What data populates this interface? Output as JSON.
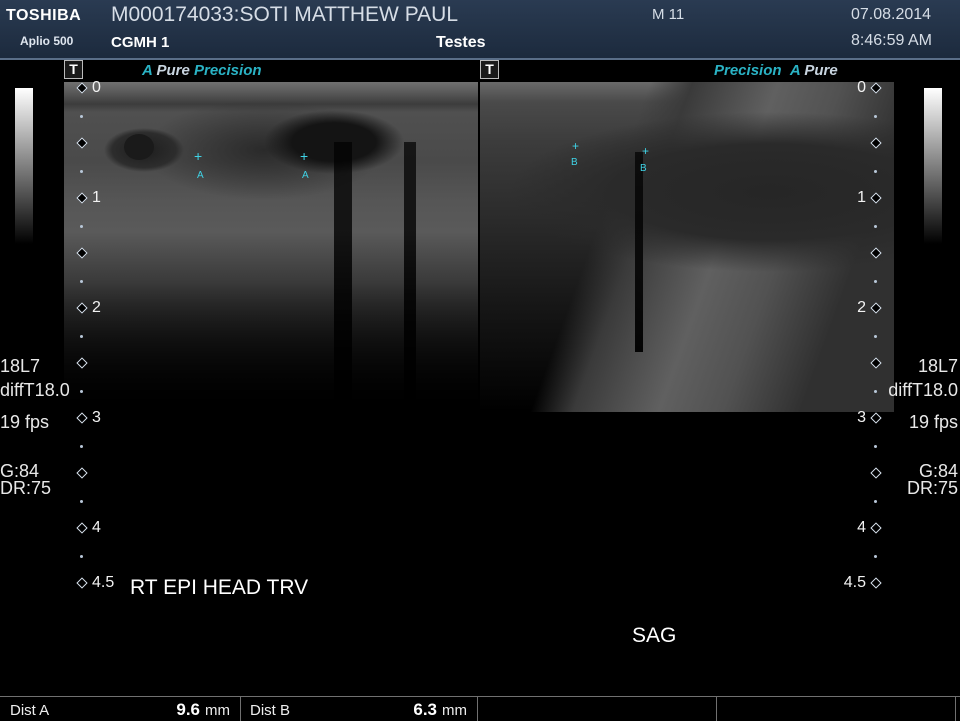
{
  "header": {
    "brand": "TOSHIBA",
    "model": "Aplio 500",
    "patient": "M000174033:SOTI MATTHEW PAUL",
    "facility": "CGMH 1",
    "study": "Testes",
    "mi": "M 11",
    "date": "07.08.2014",
    "time": "8:46:59 AM"
  },
  "panes": {
    "left": {
      "badge": "T",
      "tag_a": "A",
      "tag_word_1": "Pure",
      "tag_word_2": "Precision",
      "annotation": "RT EPI HEAD TRV",
      "caliper_label": "A"
    },
    "right": {
      "badge": "T",
      "tag_word_1": "Precision",
      "tag_a": "A",
      "tag_word_2": "Pure",
      "annotation": "SAG",
      "caliper_label": "B"
    }
  },
  "settings": {
    "probe": "18L7",
    "mode": "diffT18.0",
    "fps": "19 fps",
    "gain": "G:84",
    "dr": "DR:75"
  },
  "scale_labels": [
    "0",
    "1",
    "2",
    "3",
    "4",
    "4.5"
  ],
  "measurements": [
    {
      "label": "Dist  A",
      "value": "9.6",
      "unit": "mm"
    },
    {
      "label": "Dist  B",
      "value": "6.3",
      "unit": "mm"
    }
  ],
  "colors": {
    "accent": "#2ab3c5",
    "caliper": "#3fd3e6",
    "header_bg": "#1c2a3d"
  }
}
